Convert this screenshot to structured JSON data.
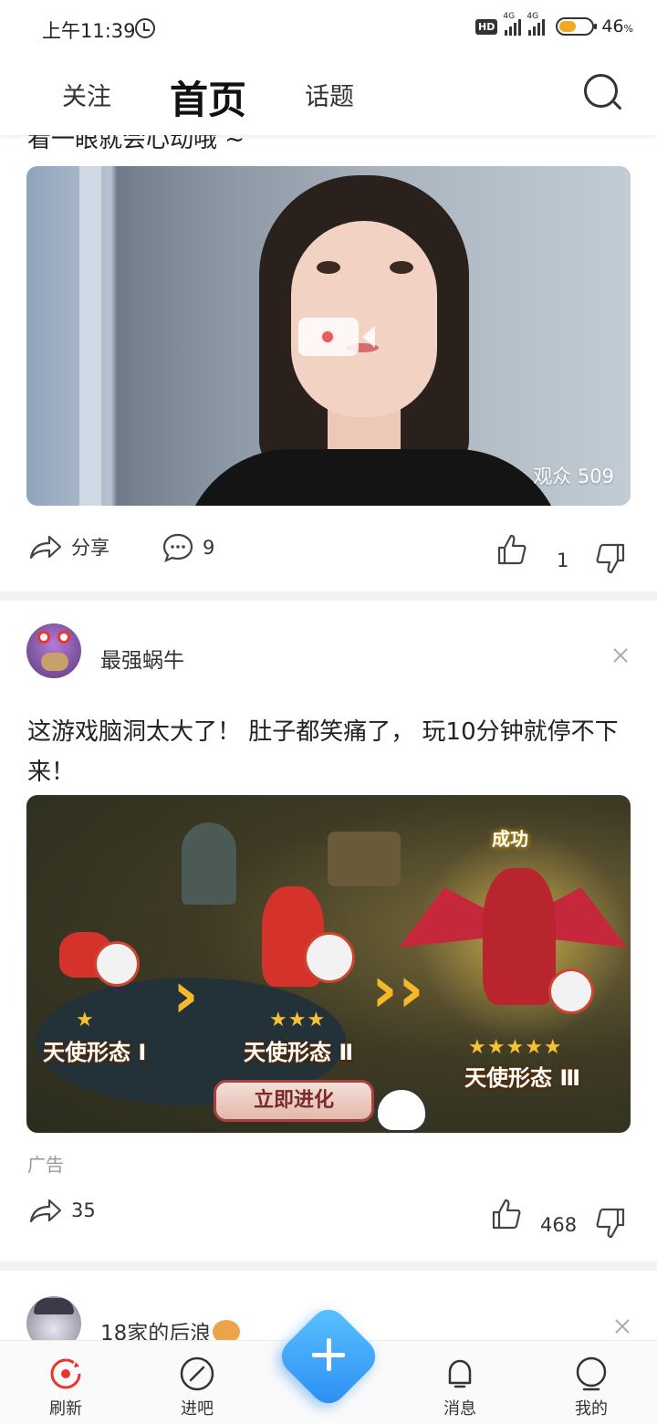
{
  "status_bar": {
    "time": "上午11:39",
    "hd": "HD",
    "net1": "4G",
    "net2": "4G",
    "battery_pct": "46",
    "battery_unit": "%"
  },
  "top_nav": {
    "tabs": [
      "关注",
      "首页",
      "话题"
    ],
    "active": "首页"
  },
  "feed": {
    "live_post": {
      "caption_cutoff": "看一眼就会心动哦 ~",
      "viewers": "观众 509",
      "share_label": "分享",
      "comments": "9",
      "likes": "1"
    },
    "ad_post": {
      "author": "最强蜗牛",
      "text": "这游戏脑洞太大了！ 肚子都笑痛了， 玩10分钟就停不下来！",
      "banner": {
        "success_badge": "成功",
        "stage1": "天使形态 Ⅰ",
        "stage2": "天使形态 Ⅱ",
        "stage3": "天使形态 Ⅲ",
        "stars1": "★",
        "stars2": "★★★",
        "stars3": "★★★★★",
        "cta": "立即进化"
      },
      "ad_label": "广告",
      "shares": "35",
      "likes": "468"
    },
    "next_post": {
      "author": "18家的后浪"
    }
  },
  "bottom_bar": {
    "items": [
      "刷新",
      "进吧",
      "消息",
      "我的"
    ]
  }
}
